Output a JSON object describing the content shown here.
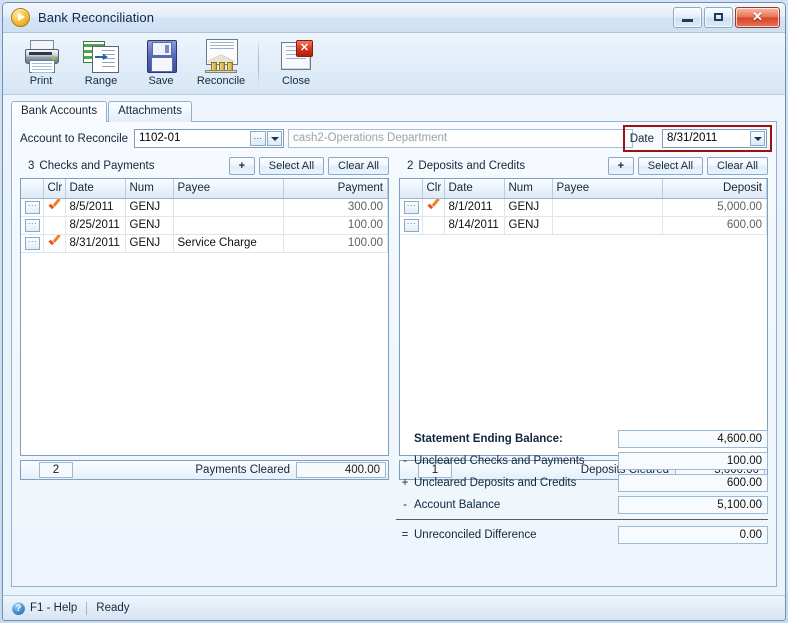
{
  "window": {
    "title": "Bank Reconciliation",
    "icon": "app-play-icon",
    "minimize_label": "–",
    "maximize_label": "□",
    "close_label": "✕"
  },
  "toolbar": {
    "items": [
      {
        "label": "Print",
        "icon": "printer-icon"
      },
      {
        "label": "Range",
        "icon": "range-grid-icon"
      },
      {
        "label": "Save",
        "icon": "floppy-disk-icon"
      },
      {
        "label": "Reconcile",
        "icon": "bank-building-icon"
      },
      {
        "label": "Close",
        "icon": "close-document-icon"
      }
    ]
  },
  "tabs": [
    {
      "label": "Bank Accounts",
      "active": true
    },
    {
      "label": "Attachments",
      "active": false
    }
  ],
  "account": {
    "label": "Account to Reconcile",
    "value": "1102-01",
    "lookup_label": "…",
    "description": "cash2-Operations Department",
    "date_label": "Date",
    "date_value": "8/31/2011",
    "highlight_color": "#9c1212"
  },
  "checks_panel": {
    "count": "3",
    "title": "Checks and Payments",
    "add_label": "+",
    "select_all_label": "Select All",
    "clear_all_label": "Clear All",
    "columns": [
      "",
      "Clr",
      "Date",
      "Num",
      "Payee",
      "Payment"
    ],
    "rows": [
      {
        "dots": "···",
        "cleared": true,
        "date": "8/5/2011",
        "num": "GENJ",
        "payee": "",
        "amount": "300.00"
      },
      {
        "dots": "···",
        "cleared": false,
        "date": "8/25/2011",
        "num": "GENJ",
        "payee": "",
        "amount": "100.00"
      },
      {
        "dots": "···",
        "cleared": true,
        "date": "8/31/2011",
        "num": "GENJ",
        "payee": "Service Charge",
        "amount": "100.00"
      }
    ],
    "footer_count": "2",
    "footer_label": "Payments Cleared",
    "footer_value": "400.00"
  },
  "deposits_panel": {
    "count": "2",
    "title": "Deposits and Credits",
    "add_label": "+",
    "select_all_label": "Select All",
    "clear_all_label": "Clear All",
    "columns": [
      "",
      "Clr",
      "Date",
      "Num",
      "Payee",
      "Deposit"
    ],
    "rows": [
      {
        "dots": "···",
        "cleared": true,
        "date": "8/1/2011",
        "num": "GENJ",
        "payee": "",
        "amount": "5,000.00"
      },
      {
        "dots": "···",
        "cleared": false,
        "date": "8/14/2011",
        "num": "GENJ",
        "payee": "",
        "amount": "600.00"
      }
    ],
    "footer_count": "1",
    "footer_label": "Deposits Cleared",
    "footer_value": "5,000.00"
  },
  "summary": {
    "rows": [
      {
        "op": "",
        "label": "Statement Ending Balance:",
        "value": "4,600.00",
        "bold": true
      },
      {
        "op": "-",
        "label": "Uncleared Checks and Payments",
        "value": "100.00",
        "bold": false
      },
      {
        "op": "+",
        "label": "Uncleared Deposits and Credits",
        "value": "600.00",
        "bold": false
      },
      {
        "op": "-",
        "label": "Account Balance",
        "value": "5,100.00",
        "bold": false
      }
    ],
    "result": {
      "op": "=",
      "label": "Unreconciled Difference",
      "value": "0.00"
    }
  },
  "statusbar": {
    "help_icon": "question-mark-icon",
    "help_label": "F1 - Help",
    "status_label": "Ready"
  }
}
